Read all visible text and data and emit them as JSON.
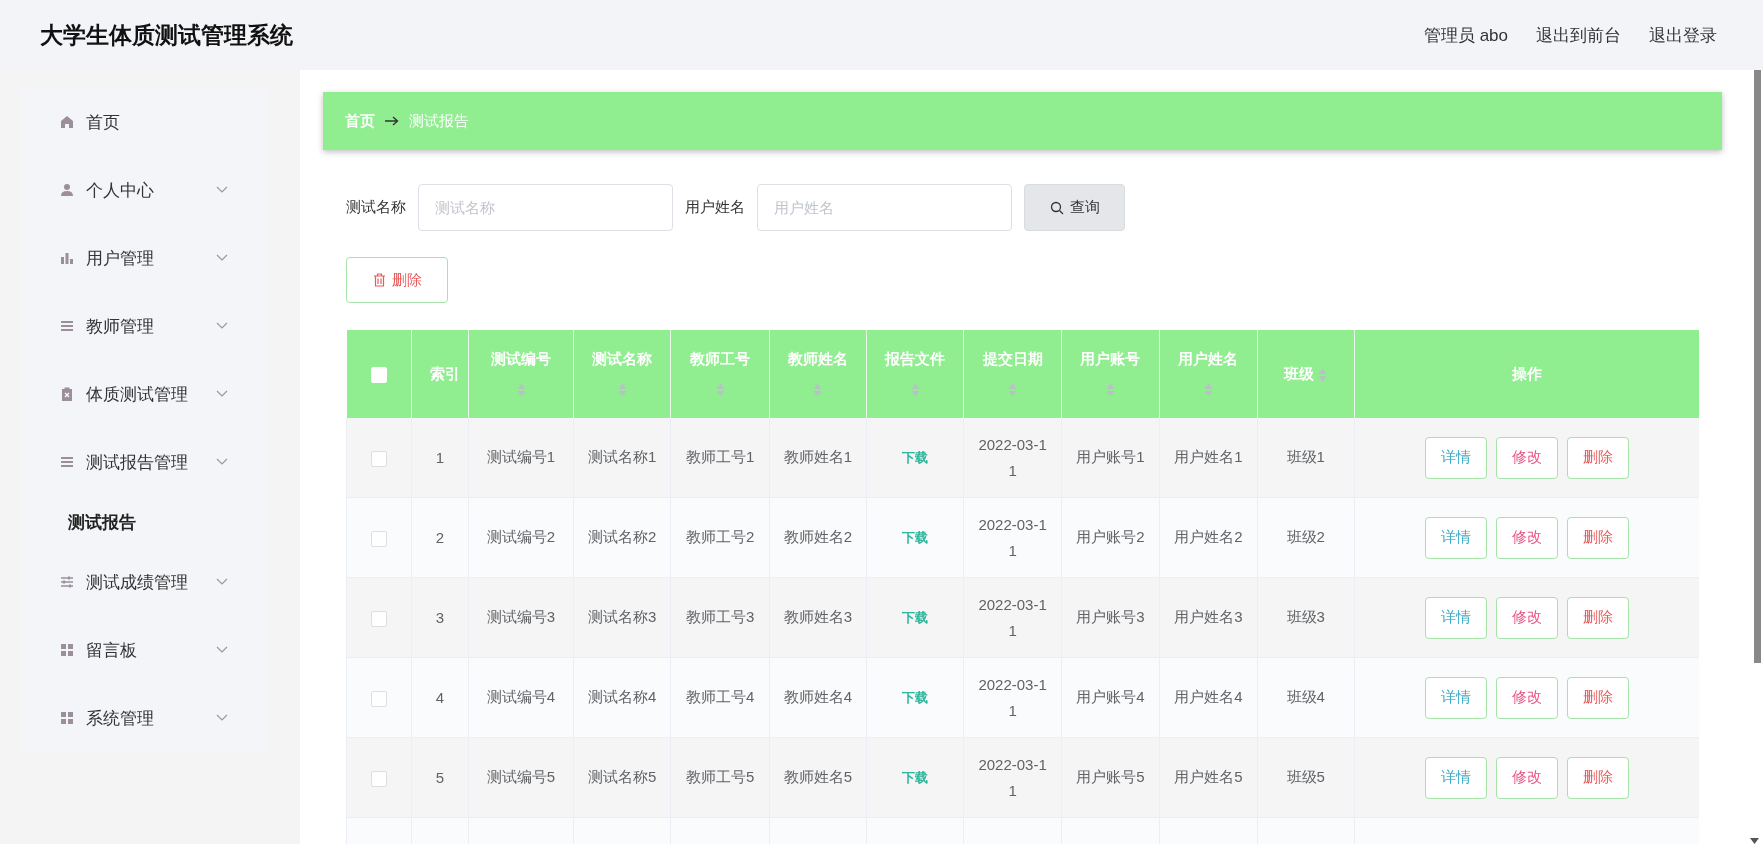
{
  "header": {
    "title": "大学生体质测试管理系统",
    "links": [
      "管理员 abo",
      "退出到前台",
      "退出登录"
    ]
  },
  "sidebar": {
    "items": [
      {
        "label": "首页",
        "kind": "link"
      },
      {
        "label": "个人中心",
        "kind": "submenu"
      },
      {
        "label": "用户管理",
        "kind": "submenu"
      },
      {
        "label": "教师管理",
        "kind": "submenu"
      },
      {
        "label": "体质测试管理",
        "kind": "submenu"
      },
      {
        "label": "测试报告管理",
        "kind": "submenu",
        "children": [
          {
            "label": "测试报告",
            "selected": true
          }
        ]
      },
      {
        "label": "测试成绩管理",
        "kind": "submenu"
      },
      {
        "label": "留言板",
        "kind": "submenu"
      },
      {
        "label": "系统管理",
        "kind": "submenu"
      }
    ]
  },
  "breadcrumb": [
    "首页",
    "测试报告"
  ],
  "search": {
    "fields": [
      {
        "label": "测试名称",
        "placeholder": "测试名称"
      },
      {
        "label": "用户姓名",
        "placeholder": "用户姓名"
      }
    ],
    "button": "查询"
  },
  "delete_button": "删除",
  "table": {
    "select_all": {
      "checked": false
    },
    "columns": [
      {
        "label": "索引",
        "sortable": false
      },
      {
        "label": "测试编号",
        "sortable": true
      },
      {
        "label": "测试名称",
        "sortable": true
      },
      {
        "label": "教师工号",
        "sortable": true
      },
      {
        "label": "教师姓名",
        "sortable": true
      },
      {
        "label": "报告文件",
        "sortable": true
      },
      {
        "label": "提交日期",
        "sortable": true
      },
      {
        "label": "用户账号",
        "sortable": true
      },
      {
        "label": "用户姓名",
        "sortable": true
      },
      {
        "label": "班级",
        "sortable": true
      },
      {
        "label": "操作",
        "sortable": false
      }
    ],
    "rows": [
      {
        "checked": false,
        "cells": [
          "1",
          "测试编号1",
          "测试名称1",
          "教师工号1",
          "教师姓名1",
          "下载",
          "2022-03-11",
          "用户账号1",
          "用户姓名1",
          "班级1"
        ],
        "actions": [
          "详情",
          "修改",
          "删除"
        ]
      },
      {
        "checked": false,
        "cells": [
          "2",
          "测试编号2",
          "测试名称2",
          "教师工号2",
          "教师姓名2",
          "下载",
          "2022-03-11",
          "用户账号2",
          "用户姓名2",
          "班级2"
        ],
        "actions": [
          "详情",
          "修改",
          "删除"
        ]
      },
      {
        "checked": false,
        "cells": [
          "3",
          "测试编号3",
          "测试名称3",
          "教师工号3",
          "教师姓名3",
          "下载",
          "2022-03-11",
          "用户账号3",
          "用户姓名3",
          "班级3"
        ],
        "actions": [
          "详情",
          "修改",
          "删除"
        ]
      },
      {
        "checked": false,
        "cells": [
          "4",
          "测试编号4",
          "测试名称4",
          "教师工号4",
          "教师姓名4",
          "下载",
          "2022-03-11",
          "用户账号4",
          "用户姓名4",
          "班级4"
        ],
        "actions": [
          "详情",
          "修改",
          "删除"
        ]
      },
      {
        "checked": false,
        "cells": [
          "5",
          "测试编号5",
          "测试名称5",
          "教师工号5",
          "教师姓名5",
          "下载",
          "2022-03-11",
          "用户账号5",
          "用户姓名5",
          "班级5"
        ],
        "actions": [
          "详情",
          "修改",
          "删除"
        ]
      }
    ]
  }
}
